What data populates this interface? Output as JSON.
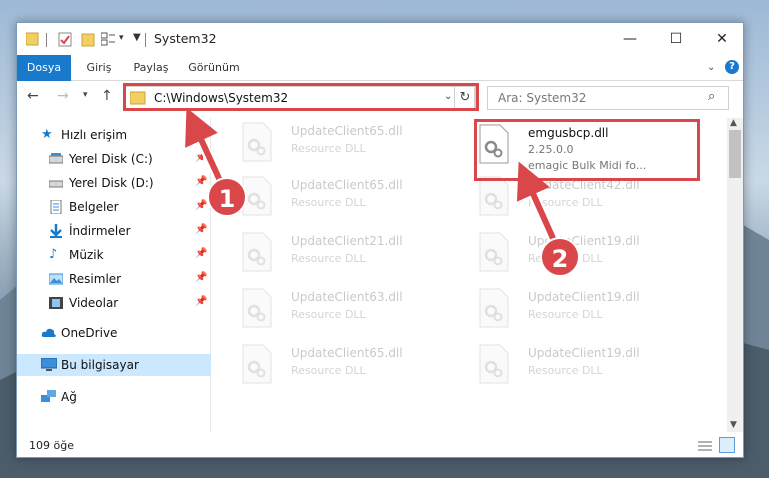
{
  "window": {
    "title": "System32"
  },
  "ribbon": {
    "tabs": [
      "Dosya",
      "Giriş",
      "Paylaş",
      "Görünüm"
    ]
  },
  "navigation": {
    "address": "C:\\Windows\\System32",
    "search_placeholder": "Ara: System32"
  },
  "sidebar": {
    "items": [
      {
        "label": "Hızlı erişim",
        "icon": "star-icon"
      },
      {
        "label": "Yerel Disk (C:)",
        "icon": "drive-icon",
        "pinned": true
      },
      {
        "label": "Yerel Disk (D:)",
        "icon": "drive-icon",
        "pinned": true
      },
      {
        "label": "Belgeler",
        "icon": "documents-icon",
        "pinned": true
      },
      {
        "label": "İndirmeler",
        "icon": "download-icon",
        "pinned": true
      },
      {
        "label": "Müzik",
        "icon": "music-icon",
        "pinned": true
      },
      {
        "label": "Resimler",
        "icon": "pictures-icon",
        "pinned": true
      },
      {
        "label": "Videolar",
        "icon": "videos-icon",
        "pinned": true
      },
      {
        "label": "OneDrive",
        "icon": "cloud-icon"
      },
      {
        "label": "Bu bilgisayar",
        "icon": "computer-icon",
        "selected": true
      },
      {
        "label": "Ağ",
        "icon": "network-icon"
      }
    ]
  },
  "files": {
    "left_column": [
      {
        "name": "UpdateClient65.dll",
        "type": "Resource DLL"
      },
      {
        "name": "UpdateClient65.dll",
        "type": "Resource DLL"
      },
      {
        "name": "UpdateClient21.dll",
        "type": "Resource DLL"
      },
      {
        "name": "UpdateClient63.dll",
        "type": "Resource DLL"
      },
      {
        "name": "UpdateClient65.dll",
        "type": "Resource DLL"
      }
    ],
    "right_column": [
      {
        "name": "UpdateClient42.dll",
        "type": "Resource DLL"
      },
      {
        "name": "UpdateClient19.dll",
        "type": "Resource DLL"
      },
      {
        "name": "UpdateClient19.dll",
        "type": "Resource DLL"
      },
      {
        "name": "UpdateClient19.dll",
        "type": "Resource DLL"
      }
    ],
    "highlighted": {
      "name": "emgusbcp.dll",
      "version": "2.25.0.0",
      "description": "emagic Bulk Midi fo..."
    }
  },
  "status": {
    "item_count": "109 öğe"
  },
  "callouts": {
    "first": "1",
    "second": "2"
  },
  "colors": {
    "accent": "#1979ca",
    "highlight_red": "#d9474b",
    "selected_bg": "#cce8ff"
  }
}
